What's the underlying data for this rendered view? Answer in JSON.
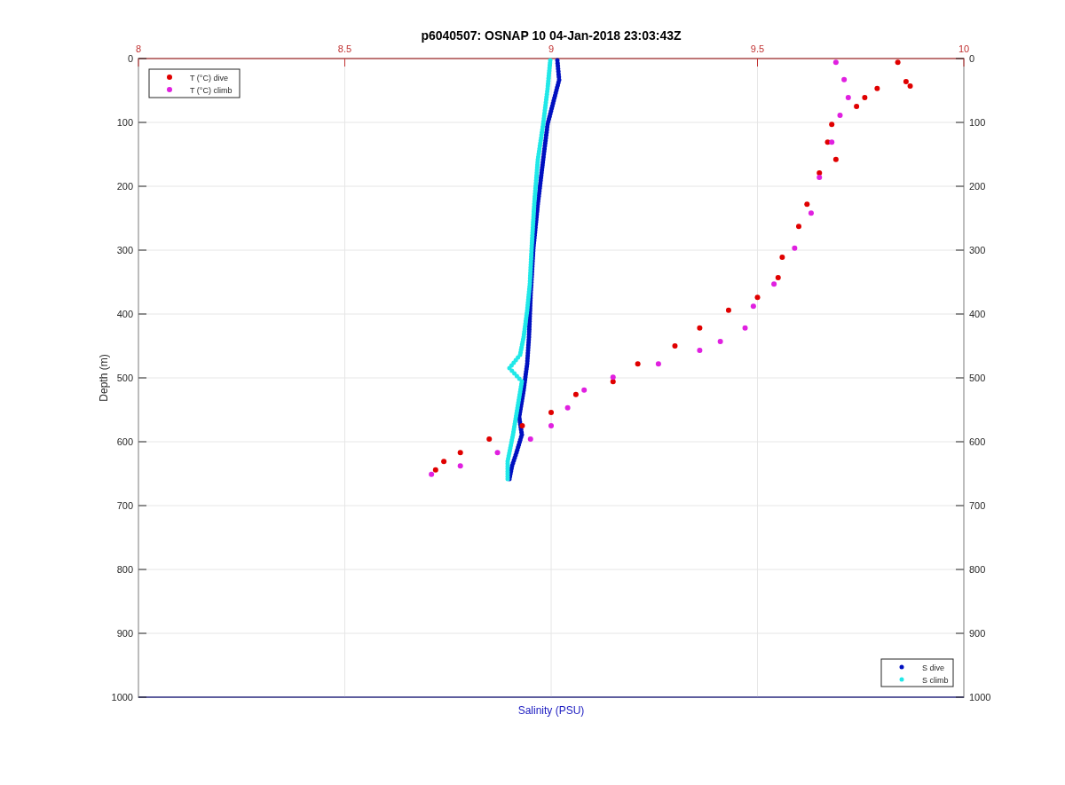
{
  "figure": {
    "chart_data": {
      "type": "scatter",
      "title": "p6040507: OSNAP 10 04-Jan-2018 23:03:43Z",
      "xlabel": "Salinity (PSU)",
      "ylabel": "Depth (m)",
      "grid": true,
      "legend": "upper left",
      "xlim": [
        8,
        10
      ],
      "ylim": [
        1000,
        0
      ],
      "xticks": [
        {
          "value": 8,
          "label": "8"
        },
        {
          "value": 8.5,
          "label": "8.5"
        },
        {
          "value": 9,
          "label": "9"
        },
        {
          "value": 9.5,
          "label": "9.5"
        },
        {
          "value": 10,
          "label": "10"
        }
      ],
      "yticks": [
        0,
        100,
        200,
        300,
        400,
        500,
        600,
        700,
        800,
        900,
        1000
      ],
      "series": [
        {
          "name": "T (°C) dive",
          "color": "#e00000",
          "x": [
            9.84,
            9.86,
            9.87,
            9.79,
            9.76,
            9.74,
            9.68,
            9.67,
            9.69,
            9.65,
            9.62,
            9.6,
            9.56,
            9.55,
            9.5,
            9.43,
            9.36,
            9.3,
            9.21,
            9.15,
            9.06,
            9.0,
            8.93,
            8.85,
            8.78,
            8.74,
            8.72
          ],
          "values": [
            6,
            36,
            43,
            47,
            61,
            75,
            103,
            131,
            158,
            179,
            228,
            263,
            311,
            343,
            374,
            394,
            422,
            450,
            478,
            506,
            526,
            554,
            575,
            596,
            617,
            631,
            644
          ]
        },
        {
          "name": "T (°C) climb",
          "color": "#e020e0",
          "x": [
            9.69,
            9.71,
            9.72,
            9.7,
            9.68,
            9.65,
            9.63,
            9.59,
            9.54,
            9.49,
            9.47,
            9.41,
            9.36,
            9.26,
            9.15,
            9.08,
            9.04,
            9.0,
            8.95,
            8.87,
            8.78,
            8.71
          ],
          "values": [
            6,
            33,
            61,
            89,
            131,
            186,
            242,
            297,
            353,
            388,
            422,
            443,
            457,
            478,
            499,
            519,
            547,
            575,
            596,
            617,
            638,
            651
          ]
        }
      ]
    },
    "right_yticks": [
      "0",
      "100",
      "200",
      "300",
      "400",
      "500",
      "600",
      "700",
      "800",
      "900",
      "1000"
    ],
    "salinity_legend": [
      {
        "label": "S dive",
        "color": "#0010c0"
      },
      {
        "label": "S climb",
        "color": "#20e8e8"
      }
    ]
  }
}
